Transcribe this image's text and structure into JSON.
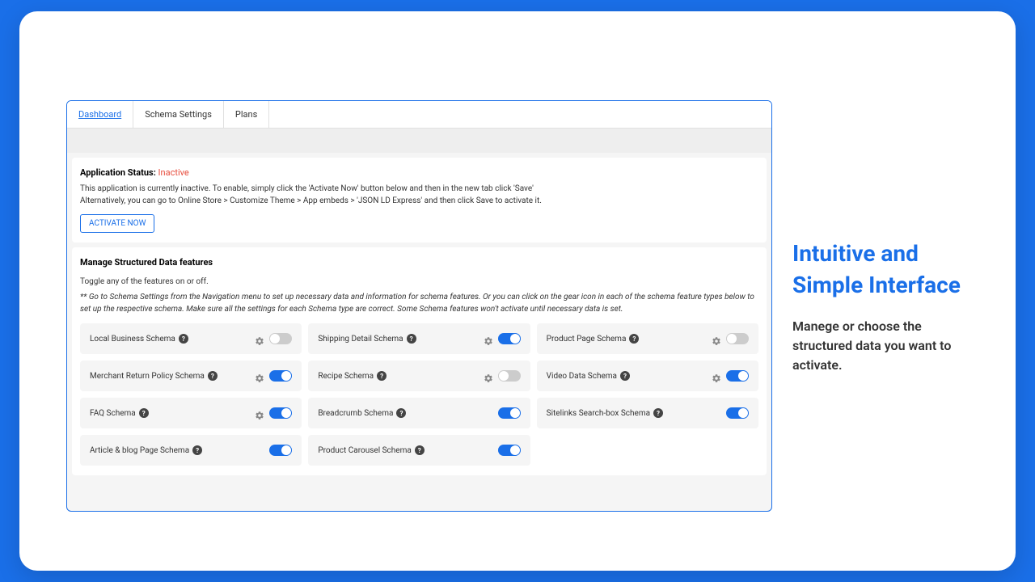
{
  "tabs": [
    {
      "label": "Dashboard",
      "active": true
    },
    {
      "label": "Schema Settings",
      "active": false
    },
    {
      "label": "Plans",
      "active": false
    }
  ],
  "status": {
    "label": "Application Status:",
    "value": "Inactive",
    "line1": "This application is currently inactive. To enable, simply click the 'Activate Now' button below and then in the new tab click 'Save'",
    "line2": "Alternatively, you can go to Online Store > Customize Theme > App embeds > 'JSON LD Express' and then click Save to activate it.",
    "button": "ACTIVATE NOW"
  },
  "features": {
    "title": "Manage Structured Data features",
    "subtitle": "Toggle any of the features on or off.",
    "note": "** Go to Schema Settings from the Navigation menu to set up necessary data and information for schema features. Or you can click on the gear icon in each of the schema feature types below to set up the respective schema. Make sure all the settings for each Schema type are correct. Some Schema features won't activate until necessary data is set."
  },
  "schemas": [
    {
      "label": "Local Business Schema",
      "gear": true,
      "on": false
    },
    {
      "label": "Shipping Detail Schema",
      "gear": true,
      "on": true
    },
    {
      "label": "Product Page Schema",
      "gear": true,
      "on": false
    },
    {
      "label": "Merchant Return Policy Schema",
      "gear": true,
      "on": true
    },
    {
      "label": "Recipe Schema",
      "gear": true,
      "on": false
    },
    {
      "label": "Video Data Schema",
      "gear": true,
      "on": true
    },
    {
      "label": "FAQ Schema",
      "gear": true,
      "on": true
    },
    {
      "label": "Breadcrumb Schema",
      "gear": false,
      "on": true
    },
    {
      "label": "Sitelinks Search-box Schema",
      "gear": false,
      "on": true
    },
    {
      "label": "Article & blog Page Schema",
      "gear": false,
      "on": true
    },
    {
      "label": "Product Carousel Schema",
      "gear": false,
      "on": true
    }
  ],
  "promo": {
    "title": "Intuitive and Simple Interface",
    "subtitle": "Manege or choose the structured data you want to activate."
  }
}
